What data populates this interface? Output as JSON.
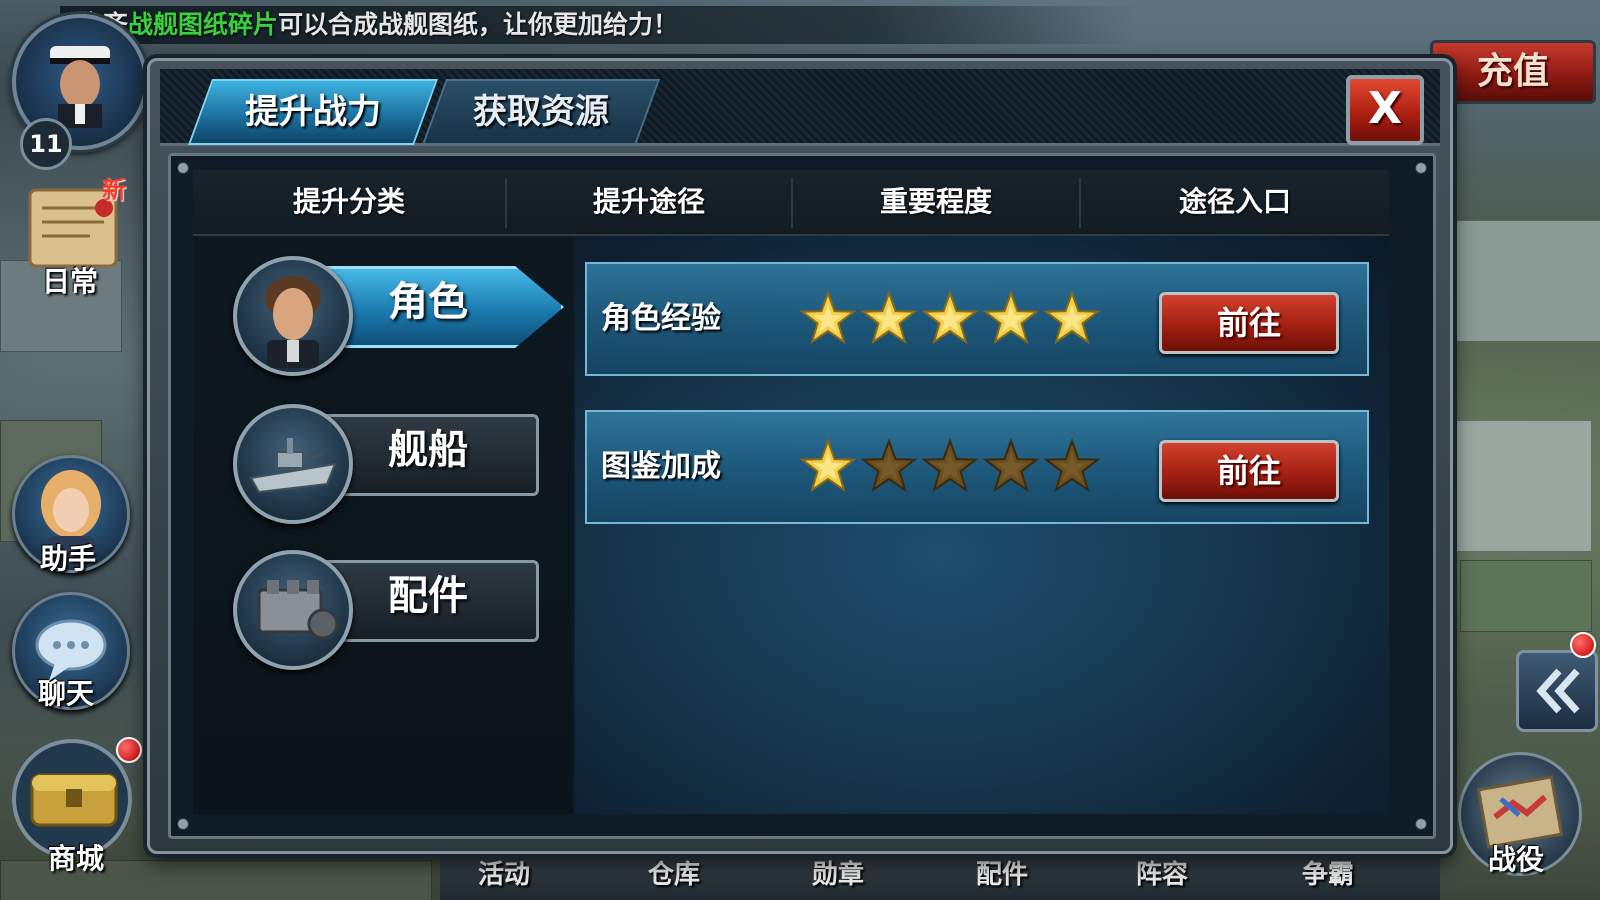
{
  "banner": {
    "prefix": "集齐",
    "highlight": "战舰图纸碎片",
    "suffix": "可以合成战舰图纸，让你更加给力！"
  },
  "player": {
    "level": "11"
  },
  "side_menu": {
    "daily": {
      "label": "日常",
      "badge": "新"
    },
    "assistant": {
      "label": "助手"
    },
    "chat": {
      "label": "聊天"
    },
    "shop": {
      "label": "商城"
    }
  },
  "top_right": {
    "recharge": "充值"
  },
  "dialog": {
    "tabs": [
      {
        "label": "提升战力",
        "active": true
      },
      {
        "label": "获取资源",
        "active": false
      }
    ],
    "close_label": "X",
    "columns": [
      "提升分类",
      "提升途径",
      "重要程度",
      "途径入口"
    ],
    "categories": [
      {
        "label": "角色",
        "icon": "officer-portrait-icon",
        "active": true
      },
      {
        "label": "舰船",
        "icon": "battleship-icon",
        "active": false
      },
      {
        "label": "配件",
        "icon": "engine-part-icon",
        "active": false
      }
    ],
    "rows": [
      {
        "label": "角色经验",
        "stars": 5,
        "max_stars": 5,
        "button": "前往"
      },
      {
        "label": "图鉴加成",
        "stars": 1,
        "max_stars": 5,
        "button": "前往"
      }
    ]
  },
  "bottom_nav": [
    "活动",
    "仓库",
    "勋章",
    "配件",
    "阵容",
    "争霸"
  ],
  "campaign": {
    "label": "战役"
  },
  "colors": {
    "star_filled": "#f2cf4a",
    "star_empty": "#6b4e1e",
    "tab_active": "#2d9bd0",
    "go_button": "#b42a17",
    "close_button": "#c2321e"
  }
}
